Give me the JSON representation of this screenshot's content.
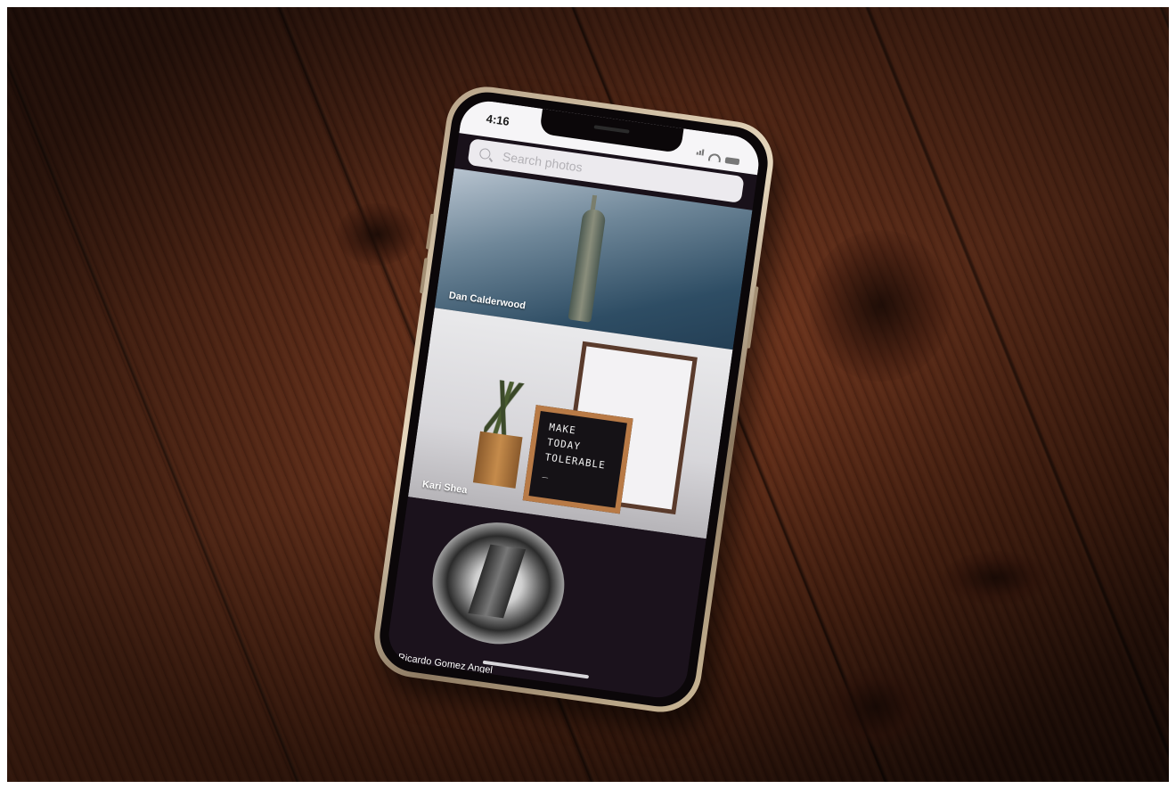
{
  "status_bar": {
    "time": "4:16",
    "icons": [
      "location-arrow-icon",
      "signal-icon",
      "wifi-icon",
      "battery-icon"
    ]
  },
  "search": {
    "placeholder": "Search photos"
  },
  "photos": [
    {
      "credit": "Dan Calderwood",
      "subject": "statue-of-liberty"
    },
    {
      "credit": "Kari Shea",
      "subject": "letterboard-plant"
    },
    {
      "credit": "Ricardo Gomez Angel",
      "subject": "building-through-tube"
    }
  ],
  "letterboard": {
    "line1": "MAKE",
    "line2": "TODAY",
    "line3": "TOLERABLE",
    "line4": "_"
  },
  "colors": {
    "wood": "#6e331c",
    "screen_background": "#19111a",
    "search_background": "#eceaee"
  }
}
